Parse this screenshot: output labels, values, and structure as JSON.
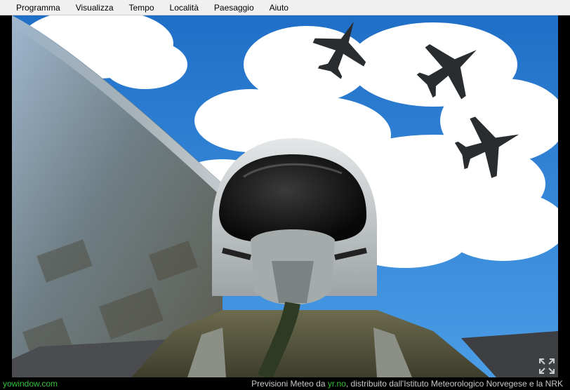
{
  "menu": {
    "items": [
      "Programma",
      "Visualizza",
      "Tempo",
      "Località",
      "Paesaggio",
      "Aiuto"
    ]
  },
  "scene": {
    "description_icon": "pilot-selfie-landscape"
  },
  "status": {
    "site": "yowindow.com",
    "attribution_prefix": "Previsioni Meteo da",
    "source_link": "yr.no",
    "attribution_suffix": ", distribuito dall'Istituto Meteorologico Norvegese e la NRK"
  },
  "colors": {
    "menubar_bg": "#f0f0f0",
    "link_green": "#36c03a",
    "status_text": "#c8c8c8",
    "sky_blue": "#2f7fd0"
  }
}
